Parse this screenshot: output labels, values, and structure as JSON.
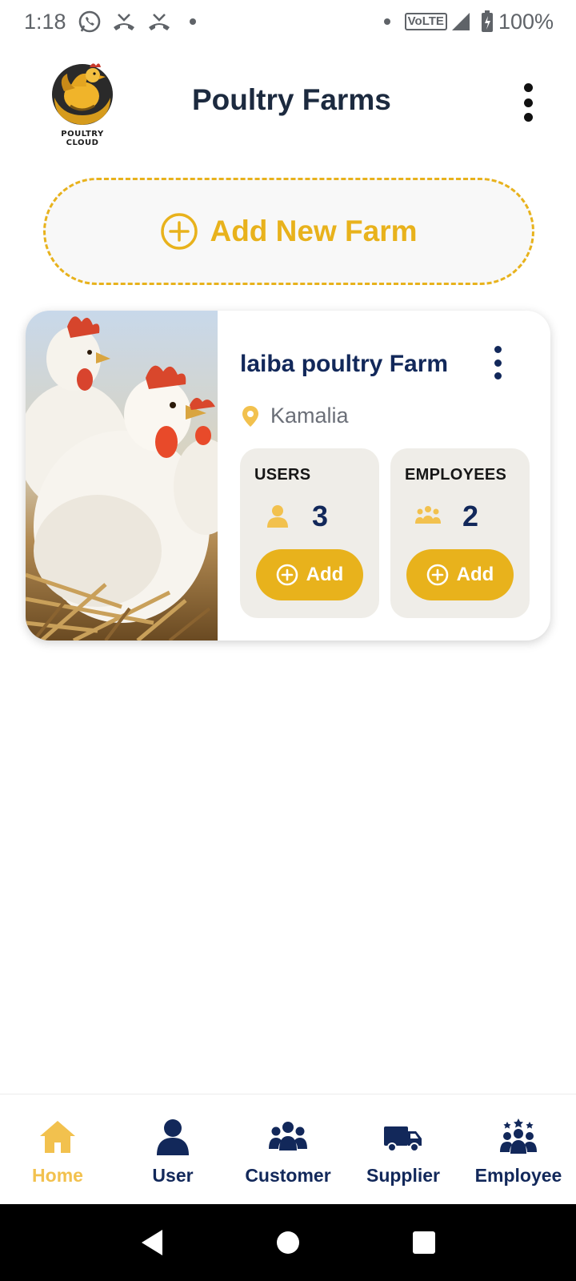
{
  "status_bar": {
    "time": "1:18",
    "network": "VoLTE",
    "battery": "100%"
  },
  "header": {
    "logo_text": "POULTRY CLOUD",
    "title": "Poultry Farms"
  },
  "add_farm": {
    "label": "Add New Farm",
    "icon": "plus-circle-icon"
  },
  "farms": [
    {
      "name": "laiba poultry Farm",
      "location": "Kamalia",
      "image": "chickens-photo",
      "users": {
        "label": "USERS",
        "count": "3",
        "button": "Add"
      },
      "employees": {
        "label": "EMPLOYEES",
        "count": "2",
        "button": "Add"
      }
    }
  ],
  "bottom_nav": {
    "items": [
      {
        "label": "Home",
        "icon": "home-icon",
        "active": true
      },
      {
        "label": "User",
        "icon": "user-icon",
        "active": false
      },
      {
        "label": "Customer",
        "icon": "customers-icon",
        "active": false
      },
      {
        "label": "Supplier",
        "icon": "truck-icon",
        "active": false
      },
      {
        "label": "Employee",
        "icon": "employees-icon",
        "active": false
      }
    ]
  },
  "colors": {
    "accent": "#e8b21c",
    "navy": "#12285a",
    "active_nav": "#f2c14e",
    "stat_bg": "#efede8"
  }
}
